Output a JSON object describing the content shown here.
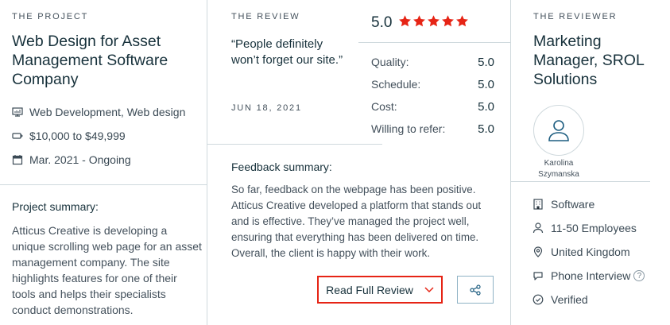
{
  "project": {
    "section_label": "THE PROJECT",
    "title": "Web Design for Asset Management Software Company",
    "services": "Web Development, Web design",
    "budget": "$10,000 to $49,999",
    "dates": "Mar. 2021 - Ongoing",
    "summary_label": "Project summary:",
    "summary_text": "Atticus Creative is developing a unique scrolling web page for an asset management company. The site highlights features for one of their tools and helps their specialists conduct demonstrations."
  },
  "review": {
    "section_label": "THE REVIEW",
    "quote": "“People definitely won’t forget our site.”",
    "date": "JUN 18, 2021",
    "overall_score": "5.0",
    "stars": 5,
    "star_color": "#e62415",
    "ratings": [
      {
        "label": "Quality:",
        "value": "5.0"
      },
      {
        "label": "Schedule:",
        "value": "5.0"
      },
      {
        "label": "Cost:",
        "value": "5.0"
      },
      {
        "label": "Willing to refer:",
        "value": "5.0"
      }
    ],
    "feedback_label": "Feedback summary:",
    "feedback_text": "So far, feedback on the webpage has been positive. Atticus Creative developed a platform that stands out and is effective. They’ve managed the project well, ensuring that everything has been delivered on time. Overall, the client is happy with their work.",
    "read_button": "Read Full Review"
  },
  "reviewer": {
    "section_label": "THE REVIEWER",
    "title": "Marketing Manager, SROL Solutions",
    "name": "Karolina Szymanska",
    "industry": "Software",
    "size": "11-50 Employees",
    "location": "United Kingdom",
    "interview": "Phone Interview",
    "interview_help": "?",
    "verified": "Verified"
  }
}
